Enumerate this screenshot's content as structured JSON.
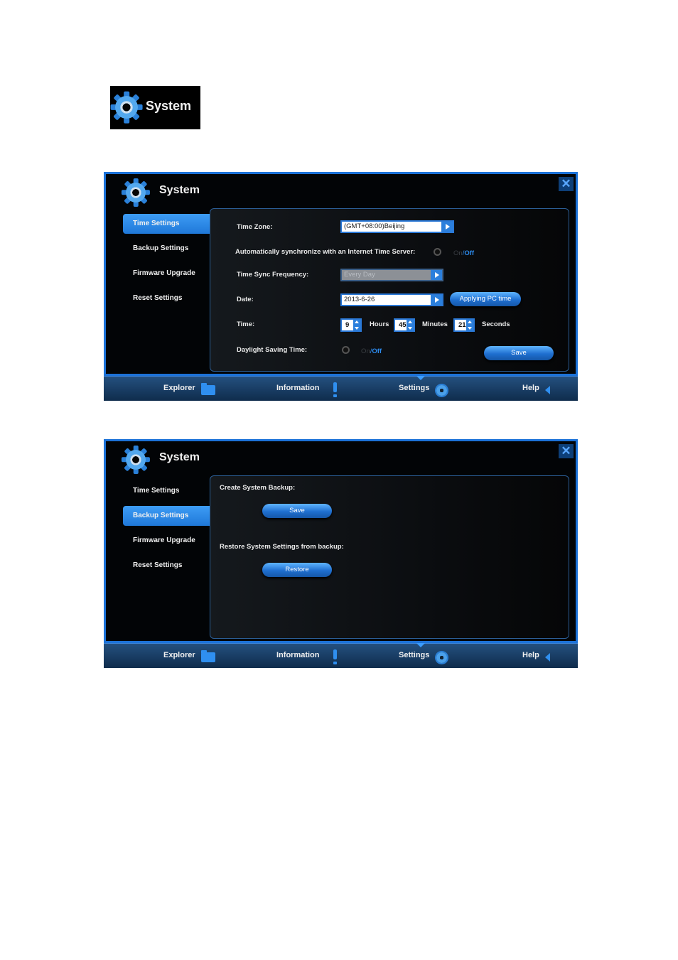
{
  "badge": {
    "title": "System"
  },
  "panel1": {
    "title": "System",
    "close": "✕",
    "sidebar": [
      "Time Settings",
      "Backup Settings",
      "Firmware Upgrade",
      "Reset Settings"
    ],
    "time_zone_label": "Time Zone:",
    "time_zone_value": "(GMT+08:00)Beijing",
    "auto_sync_label": "Automatically synchronize with an Internet Time Server:",
    "auto_sync_on": "On",
    "auto_sync_sep": "/",
    "auto_sync_off": "Off",
    "sync_freq_label": "Time Sync Frequency:",
    "sync_freq_value": "Every Day",
    "date_label": "Date:",
    "date_value": "2013-6-26",
    "applying_pc_time": "Applying PC time",
    "time_label": "Time:",
    "hours_value": "9",
    "hours_label": "Hours",
    "minutes_value": "45",
    "minutes_label": "Minutes",
    "seconds_value": "21",
    "seconds_label": "Seconds",
    "dst_label": "Daylight Saving Time:",
    "dst_on": "On",
    "dst_sep": "/",
    "dst_off": "Off",
    "save": "Save"
  },
  "panel2": {
    "title": "System",
    "close": "✕",
    "sidebar": [
      "Time Settings",
      "Backup Settings",
      "Firmware Upgrade",
      "Reset Settings"
    ],
    "create_backup_label": "Create System Backup:",
    "save": "Save",
    "restore_label": "Restore System Settings from backup:",
    "restore": "Restore"
  },
  "nav": {
    "explorer": "Explorer",
    "information": "Information",
    "settings": "Settings",
    "help": "Help"
  },
  "colors": {
    "accent": "#1c72d8",
    "active_tab": "#2f86e8",
    "off_text": "#2d8cf0"
  }
}
